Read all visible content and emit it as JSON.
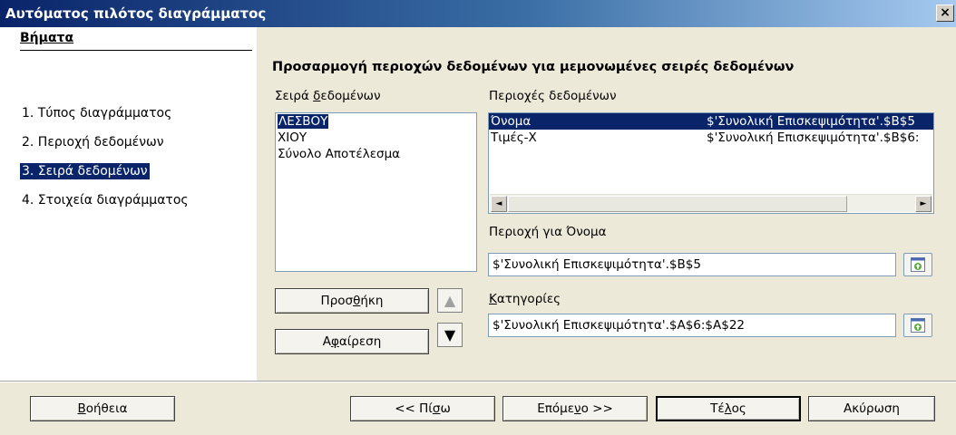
{
  "window": {
    "title": "Αυτόματος πιλότος διαγράμματος",
    "close_label": "×"
  },
  "steps": {
    "heading": "Βήματα",
    "items": [
      {
        "label": "1. Τύπος διαγράμματος"
      },
      {
        "label": "2. Περιοχή δεδομένων"
      },
      {
        "label": "3. Σειρά δεδομένων",
        "active": true
      },
      {
        "label": "4. Στοιχεία διαγράμματος"
      }
    ]
  },
  "main": {
    "title": "Προσαρμογή περιοχών δεδομένων για μεμονωμένες σειρές δεδομένων",
    "series_label_pre": "Σειρά ",
    "series_label_mn": "δ",
    "series_label_post": "εδομένων",
    "series": [
      "ΛΕΣΒΟΥ",
      "ΧΙΟΥ",
      "Σύνολο Αποτέλεσμα"
    ],
    "ranges_label_pre": "Περιο",
    "ranges_label_mn": "χ",
    "ranges_label_post": "ές δεδομένων",
    "ranges": [
      {
        "role": "Όνομα",
        "range": "$'Συνολική Επισκεψιμότητα'.$B$5"
      },
      {
        "role": "Τιμές-Χ",
        "range": "$'Συνολική Επισκεψιμότητα'.$B$6:"
      }
    ],
    "range_for_label_pre": "Περιο",
    "range_for_label_mn": "χ",
    "range_for_label_post": "ή για Όνομα",
    "range_for_value": "$'Συνολική Επισκεψιμότητα'.$B$5",
    "categories_label_mn": "Κ",
    "categories_label_post": "ατηγορίες",
    "categories_value": "$'Συνολική Επισκεψιμότητα'.$A$6:$A$22",
    "add_pre": "Προσ",
    "add_mn": "θ",
    "add_post": "ήκη",
    "remove_pre": "Α",
    "remove_mn": "φ",
    "remove_post": "αίρεση",
    "move_up_glyph": "▲",
    "move_down_glyph": "▼",
    "scroll_left_glyph": "◄",
    "scroll_right_glyph": "►"
  },
  "footer": {
    "help_mn": "Β",
    "help_post": "οήθεια",
    "back_pre": "<< Πί",
    "back_mn": "σ",
    "back_post": "ω",
    "next_pre": "Επόμε",
    "next_mn": "ν",
    "next_post": "ο >>",
    "finish_pre": "Τέ",
    "finish_mn": "λ",
    "finish_post": "ος",
    "cancel": "Ακύρωση"
  }
}
